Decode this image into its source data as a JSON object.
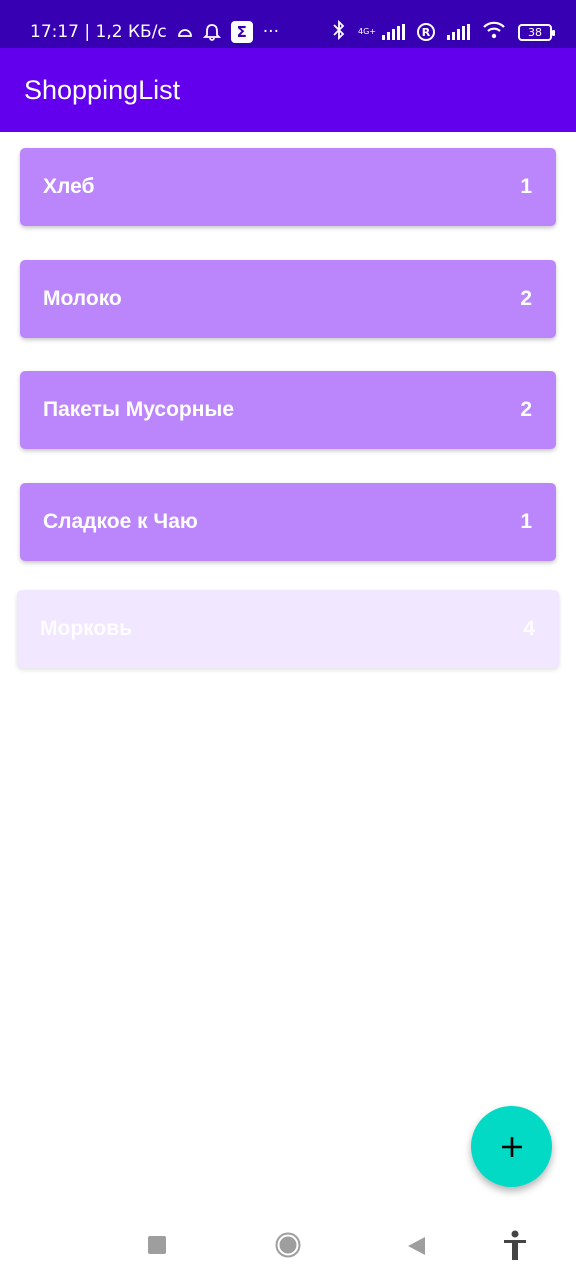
{
  "status_bar": {
    "time_and_speed": "17:17 | 1,2 КБ/с",
    "more": "···",
    "network_tag": "4G+",
    "roaming": "R",
    "battery": "38",
    "icons": [
      "cloud-icon",
      "alarm-icon",
      "sigma-icon",
      "bluetooth-icon",
      "signal-icon",
      "wifi-icon",
      "battery-icon"
    ]
  },
  "app_bar": {
    "title": "ShoppingList"
  },
  "items": [
    {
      "name": "Хлеб",
      "count": "1"
    },
    {
      "name": "Молоко",
      "count": "2"
    },
    {
      "name": "Пакеты Мусорные",
      "count": "2"
    },
    {
      "name": "Сладкое к Чаю",
      "count": "1"
    },
    {
      "name": "Морковь",
      "count": "4"
    }
  ],
  "fab": {
    "icon": "plus-icon"
  },
  "nav_bar": {
    "icons": [
      "recents-icon",
      "home-icon",
      "back-icon",
      "accessibility-icon"
    ]
  },
  "colors": {
    "status_bar": "#3700b3",
    "app_bar": "#6200ee",
    "item": "#bb86fc",
    "item_dragging": "#f1e7fe",
    "fab": "#03dac5"
  }
}
